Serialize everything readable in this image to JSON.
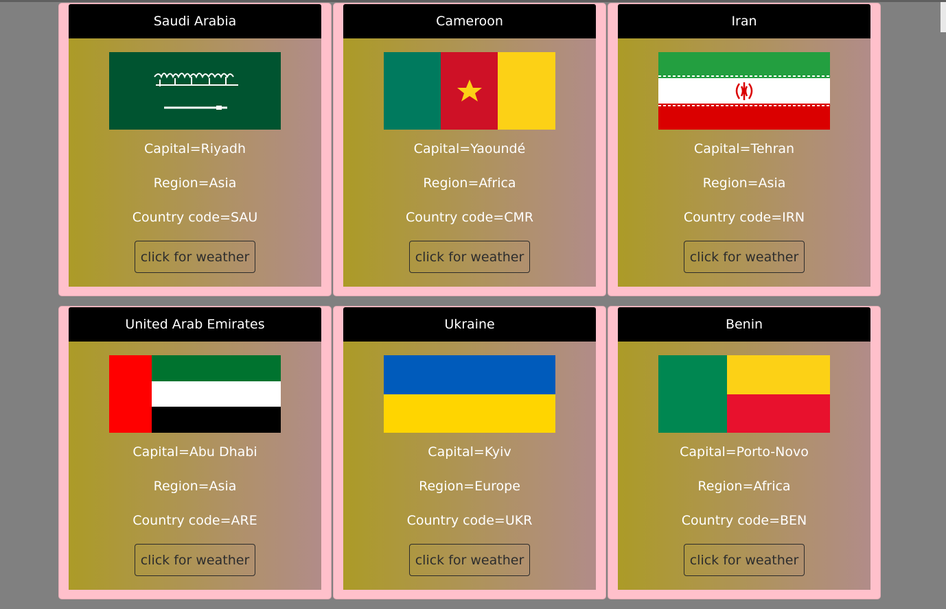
{
  "button_label": "click for weather",
  "countries": [
    {
      "name": "Saudi Arabia",
      "capital": "Capital=Riyadh",
      "region": "Region=Asia",
      "code": "Country code=SAU",
      "flag_icon": "saudi-arabia-flag-icon"
    },
    {
      "name": "Cameroon",
      "capital": "Capital=Yaoundé",
      "region": "Region=Africa",
      "code": "Country code=CMR",
      "flag_icon": "cameroon-flag-icon"
    },
    {
      "name": "Iran",
      "capital": "Capital=Tehran",
      "region": "Region=Asia",
      "code": "Country code=IRN",
      "flag_icon": "iran-flag-icon"
    },
    {
      "name": "United Arab Emirates",
      "capital": "Capital=Abu Dhabi",
      "region": "Region=Asia",
      "code": "Country code=ARE",
      "flag_icon": "uae-flag-icon"
    },
    {
      "name": "Ukraine",
      "capital": "Capital=Kyiv",
      "region": "Region=Europe",
      "code": "Country code=UKR",
      "flag_icon": "ukraine-flag-icon"
    },
    {
      "name": "Benin",
      "capital": "Capital=Porto-Novo",
      "region": "Region=Africa",
      "code": "Country code=BEN",
      "flag_icon": "benin-flag-icon"
    }
  ],
  "colors": {
    "page_bg": "#808080",
    "card_frame": "#ffc0cb",
    "card_header": "#000000",
    "gradient_start": "#ac9b27",
    "gradient_end": "#b18c89"
  }
}
